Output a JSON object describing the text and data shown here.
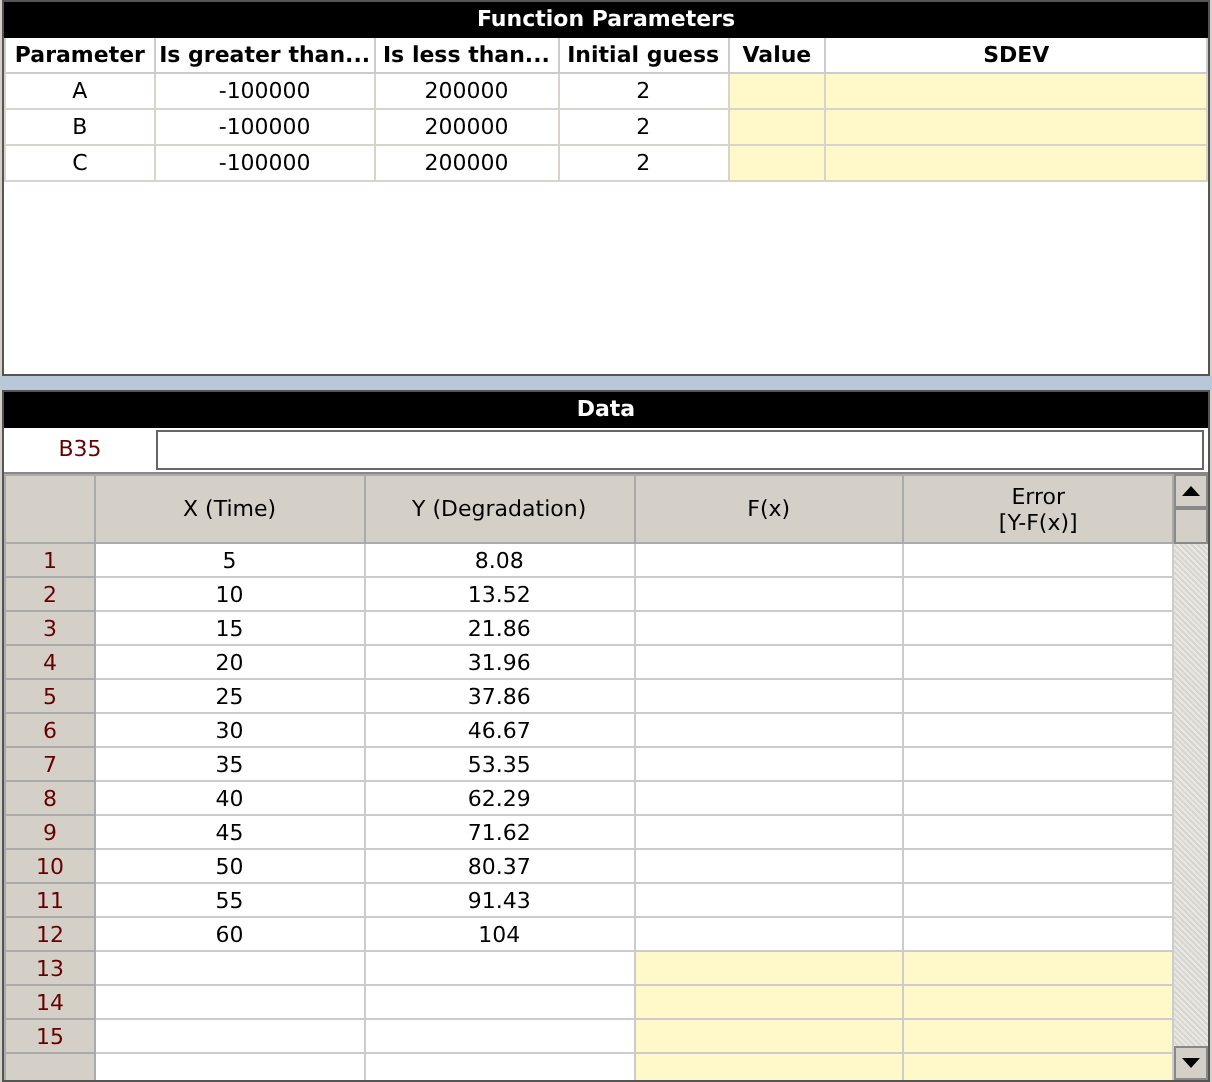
{
  "function_parameters": {
    "title": "Function Parameters",
    "columns": [
      {
        "label": "Parameter",
        "highlighted": false
      },
      {
        "label": "Is greater than...",
        "highlighted": false
      },
      {
        "label": "Is less than...",
        "highlighted": false
      },
      {
        "label": "Initial guess",
        "highlighted": false
      },
      {
        "label": "Value",
        "highlighted": true
      },
      {
        "label": "SDEV",
        "highlighted": true
      }
    ],
    "rows": [
      [
        "A",
        "-100000",
        "200000",
        "2",
        "",
        ""
      ],
      [
        "B",
        "-100000",
        "200000",
        "2",
        "",
        ""
      ],
      [
        "C",
        "-100000",
        "200000",
        "2",
        "",
        ""
      ]
    ]
  },
  "data": {
    "title": "Data",
    "cell_ref": "B35",
    "columns": [
      "X (Time)",
      "Y (Degradation)",
      "F(x)",
      "Error\n[Y-F(x)]"
    ],
    "rows": [
      {
        "label": "1",
        "cells": [
          "5",
          "8.08",
          "",
          ""
        ],
        "highlighted": false
      },
      {
        "label": "2",
        "cells": [
          "10",
          "13.52",
          "",
          ""
        ],
        "highlighted": false
      },
      {
        "label": "3",
        "cells": [
          "15",
          "21.86",
          "",
          ""
        ],
        "highlighted": false
      },
      {
        "label": "4",
        "cells": [
          "20",
          "31.96",
          "",
          ""
        ],
        "highlighted": false
      },
      {
        "label": "5",
        "cells": [
          "25",
          "37.86",
          "",
          ""
        ],
        "highlighted": false
      },
      {
        "label": "6",
        "cells": [
          "30",
          "46.67",
          "",
          ""
        ],
        "highlighted": false
      },
      {
        "label": "7",
        "cells": [
          "35",
          "53.35",
          "",
          ""
        ],
        "highlighted": false
      },
      {
        "label": "8",
        "cells": [
          "40",
          "62.29",
          "",
          ""
        ],
        "highlighted": false
      },
      {
        "label": "9",
        "cells": [
          "45",
          "71.62",
          "",
          ""
        ],
        "highlighted": false
      },
      {
        "label": "10",
        "cells": [
          "50",
          "80.37",
          "",
          ""
        ],
        "highlighted": false
      },
      {
        "label": "11",
        "cells": [
          "55",
          "91.43",
          "",
          ""
        ],
        "highlighted": false
      },
      {
        "label": "12",
        "cells": [
          "60",
          "104",
          "",
          ""
        ],
        "highlighted": false
      },
      {
        "label": "13",
        "cells": [
          "",
          "",
          "",
          ""
        ],
        "highlighted": true
      },
      {
        "label": "14",
        "cells": [
          "",
          "",
          "",
          ""
        ],
        "highlighted": true
      },
      {
        "label": "15",
        "cells": [
          "",
          "",
          "",
          ""
        ],
        "highlighted": true
      }
    ]
  }
}
